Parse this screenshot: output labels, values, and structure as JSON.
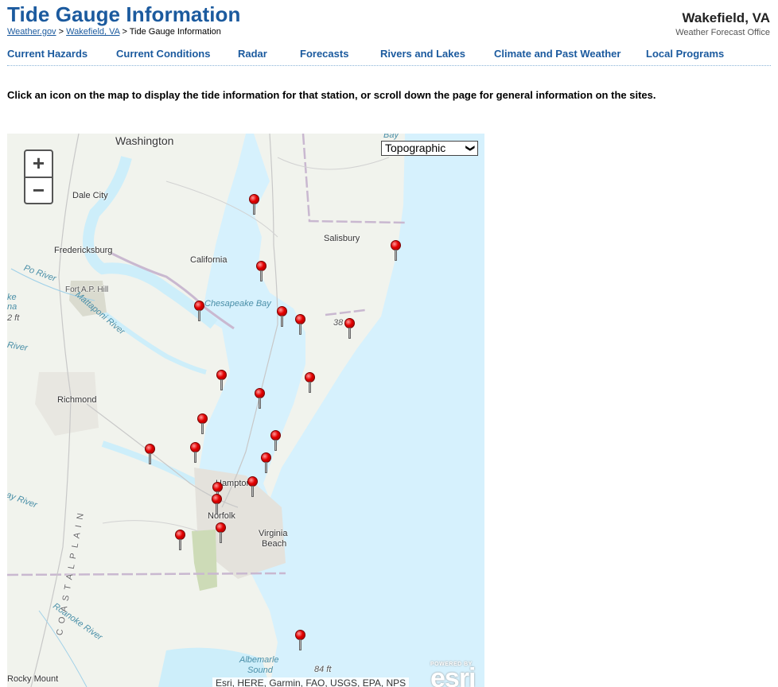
{
  "header": {
    "title": "Tide Gauge Information",
    "breadcrumb": [
      {
        "label": "Weather.gov",
        "link": true
      },
      {
        "label": "Wakefield, VA",
        "link": true
      },
      {
        "label": "Tide Gauge Information",
        "link": false
      }
    ],
    "separator": ">",
    "office_name": "Wakefield, VA",
    "office_subtitle": "Weather Forecast Office"
  },
  "nav": {
    "items": [
      {
        "label": "Current Hazards"
      },
      {
        "label": "Current Conditions"
      },
      {
        "label": "Radar"
      },
      {
        "label": "Forecasts"
      },
      {
        "label": "Rivers and Lakes"
      },
      {
        "label": "Climate and Past Weather"
      },
      {
        "label": "Local Programs"
      }
    ]
  },
  "intro_text": "Click an icon on the map to display the tide information for that station, or scroll down the page for general information on the sites.",
  "map": {
    "zoom_in_label": "+",
    "zoom_out_label": "−",
    "basemap_selected": "Topographic",
    "basemap_arrow": "❯",
    "labels": {
      "washington": "Washington",
      "dale_city": "Dale City",
      "fredericksburg": "Fredericksburg",
      "california": "California",
      "salisbury": "Salisbury",
      "fort_ap_hill": "Fort A.P. Hill",
      "chesapeake_bay": "Chesapeake Bay",
      "richmond": "Richmond",
      "hampton": "Hampton",
      "norfolk": "Norfolk",
      "virginia_beach_1": "Virginia",
      "virginia_beach_2": "Beach",
      "rocky_mount": "Rocky Mount",
      "albemarle_1": "Albemarle",
      "albemarle_2": "Sound",
      "po_river": "Po River",
      "mattaponi": "Mattaponi River",
      "roanoke_river": "Roanoke River",
      "nottoway_river": "ay River",
      "river_left": "River",
      "lake_fragment_1": "ke",
      "lake_fragment_2": "na",
      "elev_2ft": "2 ft",
      "elev_38": "38",
      "elev_84ft": "84 ft",
      "bay_top": "Bay",
      "coastal_plain": "C O A S T A L   P L A I N"
    },
    "station_count": 20,
    "attribution": "Esri, HERE, Garmin, FAO, USGS, EPA, NPS",
    "esri_powered_by": "POWERED BY",
    "esri_logo": "esri"
  }
}
